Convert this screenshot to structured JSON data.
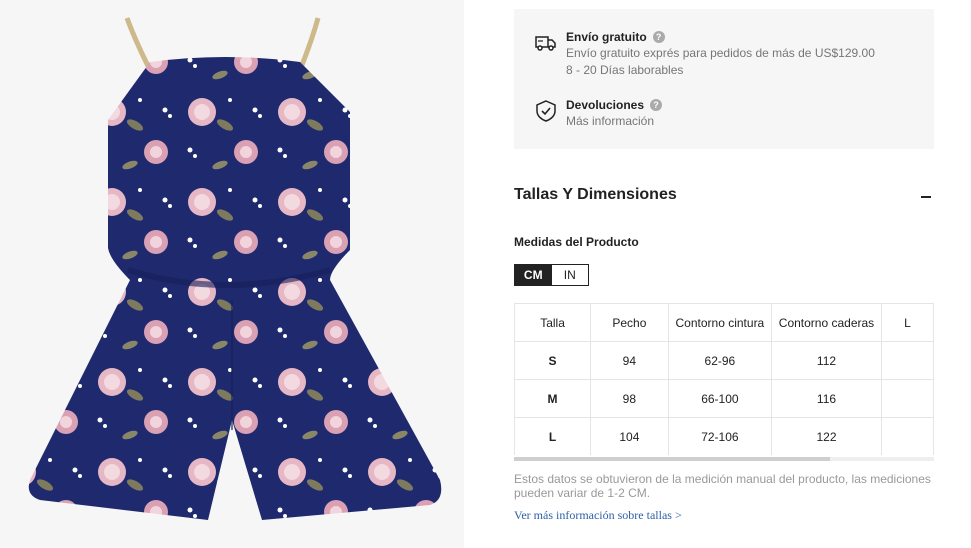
{
  "image": {
    "alt_icon": "product-photo"
  },
  "shipping": {
    "icon": "truck-icon",
    "title": "Envío gratuito",
    "line1": "Envío gratuito exprés para pedidos de más de US$129.00",
    "line2": "8 - 20 Días laborables"
  },
  "returns": {
    "icon": "shield-check-icon",
    "title": "Devoluciones",
    "line1": "Más información"
  },
  "size_section": {
    "title": "Tallas Y Dimensiones",
    "collapse_icon": "minus-icon",
    "measure_label": "Medidas del Producto",
    "units": [
      "CM",
      "IN"
    ],
    "active_unit": "CM"
  },
  "size_table": {
    "headers": [
      "Talla",
      "Pecho",
      "Contorno cintura",
      "Contorno caderas",
      "L"
    ],
    "rows": [
      [
        "S",
        "94",
        "62-96",
        "112",
        ""
      ],
      [
        "M",
        "98",
        "66-100",
        "116",
        ""
      ],
      [
        "L",
        "104",
        "72-106",
        "122",
        ""
      ]
    ]
  },
  "note": "Estos datos se obtuvieron de la medición manual del producto, las mediciones pueden variar de 1-2 CM.",
  "more_link": "Ver más información sobre tallas >"
}
